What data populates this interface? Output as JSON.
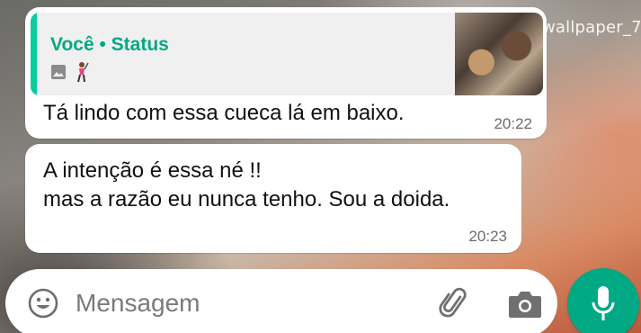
{
  "wallpaper_label": "wallpaper_7",
  "messages": [
    {
      "quote": {
        "author": "Você • Status"
      },
      "text": "Tá lindo com essa cueca lá em baixo.",
      "time": "20:22"
    },
    {
      "line1": "A intenção é essa né !!",
      "line2": "mas a razão eu nunca tenho. Sou a doida.",
      "time": "20:23"
    }
  ],
  "composer": {
    "placeholder": "Mensagem"
  },
  "colors": {
    "accent": "#00a884",
    "quote_author": "#06a884",
    "bubble": "#ffffff"
  },
  "icons": [
    "image-icon",
    "golfer-icon",
    "emoji-icon",
    "attach-clip-icon",
    "camera-icon",
    "mic-icon"
  ]
}
